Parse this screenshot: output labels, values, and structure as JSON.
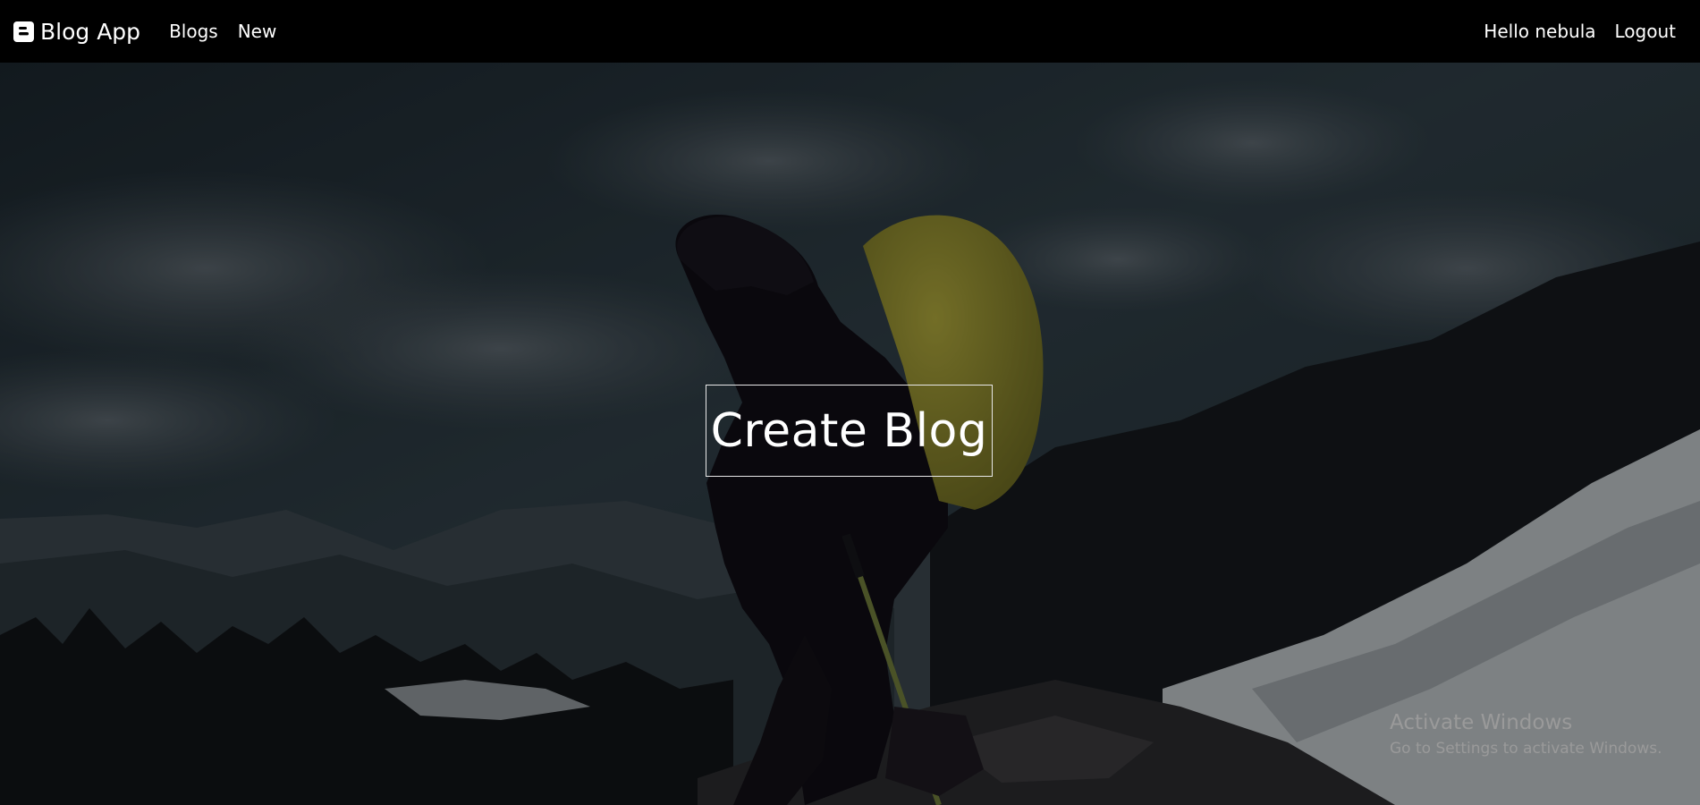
{
  "navbar": {
    "brand_icon": "blogger-icon",
    "brand_label": "Blog App",
    "links": [
      {
        "label": "Blogs"
      },
      {
        "label": "New"
      }
    ],
    "greeting": "Hello nebula",
    "logout_label": "Logout"
  },
  "hero": {
    "button_label": "Create Blog"
  },
  "watermark": {
    "title": "Activate Windows",
    "subtitle": "Go to Settings to activate Windows."
  },
  "colors": {
    "navbar_bg": "#000000",
    "text": "#ffffff",
    "backpack": "#9c9532",
    "sky": "#2a3b44"
  }
}
